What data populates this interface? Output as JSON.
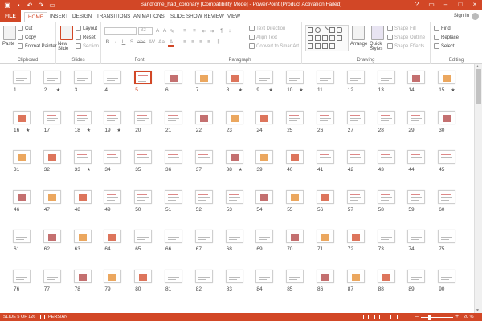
{
  "titlebar": {
    "title": "Sandrome_had_coronary [Compatibility Mode] - PowerPoint (Product Activation Failed)",
    "save_icon": "save-icon",
    "undo_icon": "undo-icon",
    "redo_icon": "redo-icon",
    "help": "?",
    "minimize": "–",
    "restore": "□",
    "close": "×"
  },
  "tabs": [
    "FILE",
    "HOME",
    "INSERT",
    "DESIGN",
    "TRANSITIONS",
    "ANIMATIONS",
    "SLIDE SHOW",
    "REVIEW",
    "VIEW"
  ],
  "sign_in": "Sign in",
  "ribbon": {
    "clipboard": {
      "label": "Clipboard",
      "paste": "Paste",
      "cut": "Cut",
      "copy": "Copy",
      "format_painter": "Format Painter"
    },
    "slides": {
      "label": "Slides",
      "new_slide": "New Slide",
      "layout": "Layout",
      "reset": "Reset",
      "section": "Section"
    },
    "font": {
      "label": "Font",
      "size": "32",
      "bold": "B",
      "italic": "I",
      "underline": "U",
      "shadow": "S",
      "strike": "abc",
      "spacing": "AV",
      "case": "Aa",
      "color": "A"
    },
    "paragraph": {
      "label": "Paragraph",
      "text_direction": "Text Direction",
      "align_text": "Align Text",
      "convert": "Convert to SmartArt"
    },
    "drawing": {
      "label": "Drawing",
      "arrange": "Arrange",
      "quick_styles": "Quick Styles",
      "shape_fill": "Shape Fill",
      "shape_outline": "Shape Outline",
      "shape_effects": "Shape Effects"
    },
    "editing": {
      "label": "Editing",
      "find": "Find",
      "replace": "Replace",
      "select": "Select"
    }
  },
  "slides": {
    "numbers": [
      1,
      2,
      3,
      4,
      5,
      6,
      7,
      8,
      9,
      10,
      11,
      12,
      13,
      14,
      15,
      16,
      17,
      18,
      19,
      20,
      21,
      22,
      23,
      24,
      25,
      26,
      27,
      28,
      29,
      30,
      31,
      32,
      33,
      34,
      35,
      36,
      37,
      38,
      39,
      40,
      41,
      42,
      43,
      44,
      45,
      46,
      47,
      48,
      49,
      50,
      51,
      52,
      53,
      54,
      55,
      56,
      57,
      58,
      59,
      60,
      61,
      62,
      63,
      64,
      65,
      66,
      67,
      68,
      69,
      70,
      71,
      72,
      73,
      74,
      75,
      76,
      77,
      78,
      79,
      80,
      81,
      82,
      83,
      84,
      85,
      86,
      87,
      88,
      89,
      90
    ],
    "starred": [
      2,
      8,
      9,
      10,
      15,
      16,
      18,
      19,
      33,
      38
    ],
    "selected": 5,
    "star_symbol": "★"
  },
  "status": {
    "slide": "SLIDE 5 OF 126",
    "language": "PERSIAN",
    "zoom_minus": "–",
    "zoom_plus": "+",
    "zoom": "20 %"
  },
  "colors": {
    "accent": "#d24726"
  }
}
